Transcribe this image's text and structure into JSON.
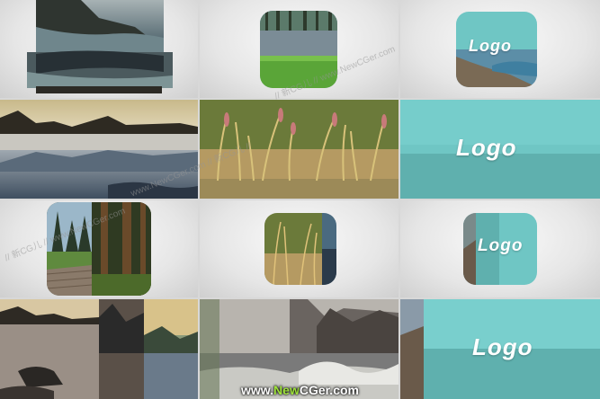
{
  "cells": {
    "logo_label": "Logo"
  },
  "watermark": {
    "text_a": "// 新CG儿 // www.NewCGer.com",
    "text_b": "www.NewCGer.com // 新CG儿 //"
  },
  "footer": {
    "prefix": "www.",
    "highlight": "New",
    "suffix": "CGer.com"
  },
  "colors": {
    "teal": "#6fc6c4",
    "teal_dark": "#5fb0ae",
    "studio_bg": "#e6e6e6",
    "brand_green": "#9fe33a"
  }
}
